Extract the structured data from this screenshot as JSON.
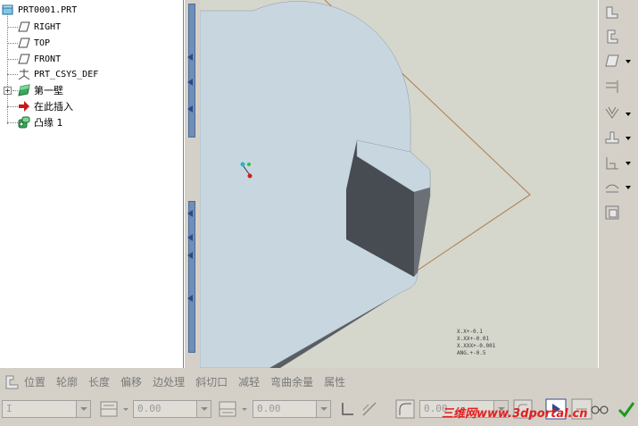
{
  "model_tree": {
    "items": [
      {
        "label": "PRT0001.PRT",
        "icon": "part-icon"
      },
      {
        "label": "RIGHT",
        "icon": "datum-plane-icon"
      },
      {
        "label": "TOP",
        "icon": "datum-plane-icon"
      },
      {
        "label": "FRONT",
        "icon": "datum-plane-icon"
      },
      {
        "label": "PRT_CSYS_DEF",
        "icon": "csys-icon"
      },
      {
        "label": "第一壁",
        "icon": "sheetmetal-wall-icon"
      },
      {
        "label": "在此插入",
        "icon": "insert-here-arrow-icon"
      },
      {
        "label": "凸缘 1",
        "icon": "flange-icon"
      }
    ]
  },
  "viewport": {
    "tolerances": [
      "X.X+-0.1",
      "X.XX+-0.01",
      "X.XXX+-0.001",
      "ANG.+-0.5"
    ]
  },
  "dashboard": {
    "tabs": [
      "位置",
      "轮廓",
      "长度",
      "偏移",
      "边处理",
      "斜切口",
      "减轻",
      "弯曲余量",
      "属性"
    ],
    "type_value": "I",
    "length1_value": "0.00",
    "length2_value": "0.00",
    "radius_value": "0.00"
  },
  "watermark": "三维网www.3dportal.cn",
  "colors": {
    "part_surface": "#c8d6e0",
    "wall_dark": "#4a4f55",
    "datum_outline": "#b07a4a",
    "viewport_bg": "#d5d6cc",
    "accept_green": "#1a9a1a"
  }
}
